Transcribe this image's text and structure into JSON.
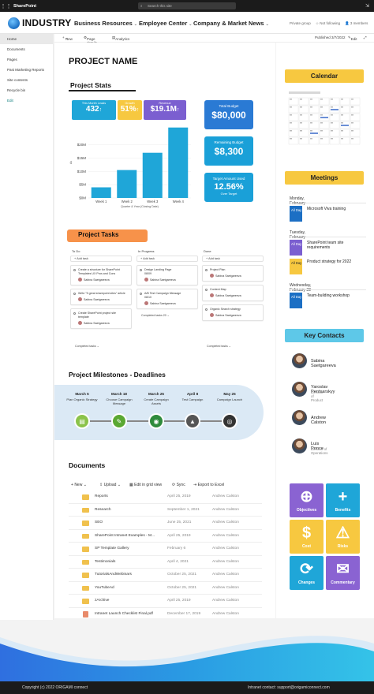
{
  "suite": {
    "brand": "SharePoint",
    "search_placeholder": "Search this site"
  },
  "header": {
    "logo_text": "INDUSTRY",
    "nav": [
      "Business Resources",
      "Employee Center",
      "Company & Market News"
    ],
    "group": "Private group",
    "follow": "Not following",
    "members": "3 members"
  },
  "left_nav": [
    "Home",
    "Documents",
    "Pages",
    "Past Marketing Reports",
    "Site contents",
    "Recycle bin",
    "Edit"
  ],
  "command_bar": {
    "new": "New",
    "page_details": "Page details",
    "analytics": "Analytics",
    "published": "Published 3/7/2022",
    "edit": "Edit"
  },
  "page_title": "PROJECT NAME",
  "stats": {
    "heading": "Project Stats",
    "cards": [
      {
        "title": "This Month Leads",
        "value": "432",
        "arrow": "↑",
        "sub": "",
        "color": "#1fa6d8"
      },
      {
        "title": "Growth",
        "value": "51%",
        "arrow": "↑",
        "sub": "",
        "color": "#f7c840"
      },
      {
        "title": "Revenue",
        "value": "$19.1M",
        "arrow": "↑",
        "sub": "",
        "color": "#7b5fd0"
      }
    ],
    "budget": [
      {
        "title": "Total Budget",
        "value": "$80,000",
        "sub": ""
      },
      {
        "title": "Remaining Budget",
        "value": "$8,300",
        "sub": ""
      },
      {
        "title": "Target Amount Used",
        "value": "12.56%",
        "sub": "Over Target"
      }
    ]
  },
  "chart_data": {
    "type": "bar",
    "categories": [
      "Week 1",
      "Week 2",
      "Week 3",
      "Week 4"
    ],
    "values": [
      4,
      10.5,
      17,
      26.5
    ],
    "yticks": [
      "$0M",
      "$5M",
      "$10M",
      "$15M",
      "$20M"
    ],
    "ytick_values": [
      0,
      5,
      10,
      15,
      20
    ],
    "ylim": [
      0,
      27
    ],
    "ylabel": "Ax",
    "xlabel": "Quarter & Year (Closing Date)",
    "color": "#1fa6d8"
  },
  "tasks": {
    "heading": "Project Tasks",
    "columns": [
      {
        "name": "To Do",
        "add": "Add task",
        "cards": [
          {
            "lines": [
              "Create a structure for SharePoint",
              "Templates UX Pros and Cons"
            ],
            "person": "Sabina Saetgareeva"
          },
          {
            "lines": [
              "Write \"5 great sharepoint sites\" article"
            ],
            "person": "Sabina Saetgareeva"
          },
          {
            "lines": [
              "Create SharePoint project site",
              "template"
            ],
            "person": "Sabina Saetgareeva"
          }
        ],
        "completed": "Completed tasks"
      },
      {
        "name": "In Progress",
        "add": "Add task",
        "cards": [
          {
            "lines": [
              "Design Landing Page",
              "08/09"
            ],
            "person": "Sabina Saetgareeva"
          },
          {
            "lines": [
              "A/B Test Campaign Message",
              "08/10"
            ],
            "person": "Sabina Saetgareeva"
          }
        ],
        "completed": "Completed tasks",
        "completed_count": "20"
      },
      {
        "name": "Done",
        "add": "Add task",
        "cards": [
          {
            "lines": [
              "Project Plan"
            ],
            "person": "Sabina Saetgareeva"
          },
          {
            "lines": [
              "Content Map"
            ],
            "person": "Sabina Saetgareeva"
          },
          {
            "lines": [
              "Organic Search strategy"
            ],
            "person": "Sabina Saetgareeva"
          }
        ],
        "completed": "Completed tasks"
      }
    ]
  },
  "milestones": {
    "heading": "Project Milestones - Deadlines",
    "items": [
      {
        "date": "March 5",
        "label": "Plan Organic Strategy",
        "color": "#8bc34a",
        "icon": "doc-icon"
      },
      {
        "date": "March 18",
        "label": "Choose Campaign Message",
        "color": "#5aa832",
        "icon": "compass-icon"
      },
      {
        "date": "March 25",
        "label": "Create Campaign Assets",
        "color": "#2e8b3c",
        "icon": "eye-icon"
      },
      {
        "date": "April 8",
        "label": "Test Campaign",
        "color": "#555555",
        "icon": "grad-cap-icon"
      },
      {
        "date": "May 25",
        "label": "Campaign Launch",
        "color": "#333333",
        "icon": "target-icon"
      }
    ]
  },
  "documents": {
    "heading": "Documents",
    "toolbar": {
      "new": "New",
      "upload": "Upload",
      "grid": "Edit in grid view",
      "sync": "Sync",
      "export": "Export to Excel"
    },
    "rows": [
      {
        "name": "Reports",
        "date": "April 25, 2019",
        "by": "Andrew Calston",
        "type": "folder"
      },
      {
        "name": "Research",
        "date": "September 1, 2021",
        "by": "Andrew Calston",
        "type": "folder"
      },
      {
        "name": "SEO",
        "date": "June 25, 2021",
        "by": "Andrew Calston",
        "type": "folder"
      },
      {
        "name": "SharePoint Intranet Examples - M...",
        "date": "April 25, 2019",
        "by": "Andrew Calston",
        "type": "folder"
      },
      {
        "name": "SP Template Gallery",
        "date": "February 6",
        "by": "Andrew Calston",
        "type": "folder"
      },
      {
        "name": "Testimonials",
        "date": "April 4, 2021",
        "by": "Andrew Calston",
        "type": "folder"
      },
      {
        "name": "TutorialsAndWebinars",
        "date": "October 25, 2021",
        "by": "Andrew Calston",
        "type": "folder"
      },
      {
        "name": "YouTubeAd",
        "date": "October 25, 2021",
        "by": "Andrew Calston",
        "type": "folder"
      },
      {
        "name": "zArchive",
        "date": "April 25, 2019",
        "by": "Andrew Calston",
        "type": "folder"
      },
      {
        "name": "Intranet Launch Checklist Final.pdf",
        "date": "December 17, 2019",
        "by": "Andrew Calston",
        "type": "file"
      }
    ]
  },
  "calendar": {
    "heading": "Calendar"
  },
  "meetings": {
    "heading": "Meetings",
    "days": [
      {
        "day": "Monday, February 21",
        "events": [
          {
            "time": "All Day",
            "title": "Microsoft Viva training",
            "color": "#1c6fc4"
          }
        ]
      },
      {
        "day": "Tuesday, February 22",
        "events": [
          {
            "time": "All Day",
            "title": "SharePoint team site requirements",
            "color": "#7b5fd0"
          },
          {
            "time": "All Day",
            "title": "Product strategy for 2022",
            "color": "#f7c840"
          }
        ]
      },
      {
        "day": "Wednesday, February 23",
        "events": [
          {
            "time": "All Day",
            "title": "Team-building workshop",
            "color": "#1c6fc4"
          }
        ]
      }
    ]
  },
  "contacts": {
    "heading": "Key Contacts",
    "people": [
      {
        "name": "Sabina Saetgareeva",
        "role": ""
      },
      {
        "name": "Yaroslav Pentsarskyy",
        "role": "Director of Product"
      },
      {
        "name": "Andrew Calston",
        "role": ""
      },
      {
        "name": "Luis Ponce",
        "role": "Director of Operations"
      }
    ]
  },
  "tiles": [
    {
      "label": "Objectives",
      "color": "#8a63d2",
      "icon": "crosshair-icon",
      "glyph": "⊕"
    },
    {
      "label": "Benefits",
      "color": "#1fa6d8",
      "icon": "plus-icon",
      "glyph": "+"
    },
    {
      "label": "Cost",
      "color": "#f7c840",
      "icon": "dollar-icon",
      "glyph": "$"
    },
    {
      "label": "Risks",
      "color": "#f7c840",
      "icon": "warning-icon",
      "glyph": "⚠"
    },
    {
      "label": "Changes",
      "color": "#1fa6d8",
      "icon": "refresh-icon",
      "glyph": "⟳"
    },
    {
      "label": "Commentary",
      "color": "#8a63d2",
      "icon": "chat-icon",
      "glyph": "✉"
    }
  ],
  "footer": {
    "copyright": "Copyright (c) 2022 ORIGAMI connect",
    "contact": "Intranet contact: support@origamiconnect.com"
  }
}
